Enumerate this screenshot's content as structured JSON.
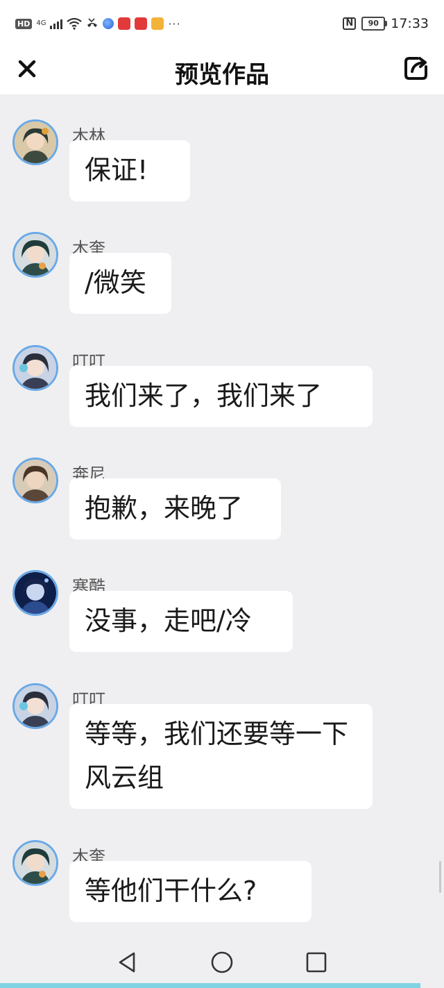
{
  "status_bar": {
    "hd": "HD",
    "network": "4G",
    "battery": "90",
    "time": "17:33",
    "nfc": "N",
    "more": "···"
  },
  "header": {
    "title": "预览作品"
  },
  "messages": [
    {
      "sender": "木林",
      "text": "保证!"
    },
    {
      "sender": "木奎",
      "text": "/微笑"
    },
    {
      "sender": "叮叮",
      "text": "我们来了，我们来了"
    },
    {
      "sender": "奔尼",
      "text": "抱歉，来晚了"
    },
    {
      "sender": "寒酷",
      "text": "没事，走吧/冷"
    },
    {
      "sender": "叮叮",
      "text": "等等，我们还要等一下风云组"
    },
    {
      "sender": "木奎",
      "text": "等他们干什么?"
    }
  ],
  "icons": {
    "close": "close-icon",
    "share": "share-icon",
    "nav_back": "back-triangle-icon",
    "nav_home": "home-circle-icon",
    "nav_recent": "recent-square-icon"
  },
  "colors": {
    "background": "#efeff1",
    "bubble": "#ffffff",
    "avatar_ring": "#6aa9e6",
    "accent": "#7fd3e3"
  }
}
